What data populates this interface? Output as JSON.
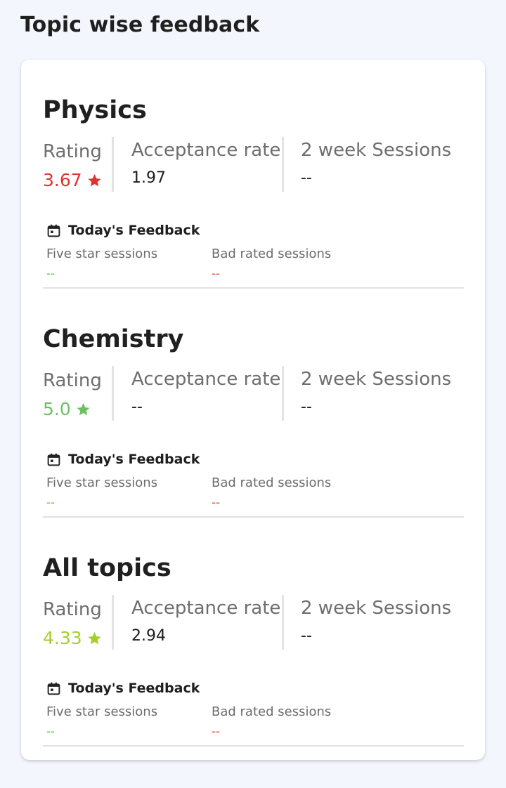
{
  "page": {
    "title": "Topic wise feedback"
  },
  "labels": {
    "rating": "Rating",
    "acceptance_rate": "Acceptance rate",
    "two_week_sessions": "2 week Sessions",
    "todays_feedback": "Today's Feedback",
    "five_star_sessions": "Five star sessions",
    "bad_rated_sessions": "Bad rated sessions"
  },
  "colors": {
    "red": "#e42f2f",
    "green": "#6cc060",
    "lime": "#a3cf2b",
    "five_star": "#6cc060",
    "bad": "#e65050"
  },
  "topics": [
    {
      "name": "Physics",
      "rating": "3.67",
      "rating_color": "#e42f2f",
      "rating_icon": "star-icon",
      "acceptance_rate": "1.97",
      "two_week_sessions": "--",
      "five_star_sessions": "--",
      "bad_rated_sessions": "--"
    },
    {
      "name": "Chemistry",
      "rating": "5.0",
      "rating_color": "#6cc060",
      "rating_icon": "star-icon",
      "acceptance_rate": "--",
      "two_week_sessions": "--",
      "five_star_sessions": "--",
      "bad_rated_sessions": "--"
    },
    {
      "name": "All topics",
      "rating": "4.33",
      "rating_color": "#a3cf2b",
      "rating_icon": "star-icon",
      "acceptance_rate": "2.94",
      "two_week_sessions": "--",
      "five_star_sessions": "--",
      "bad_rated_sessions": "--"
    }
  ]
}
